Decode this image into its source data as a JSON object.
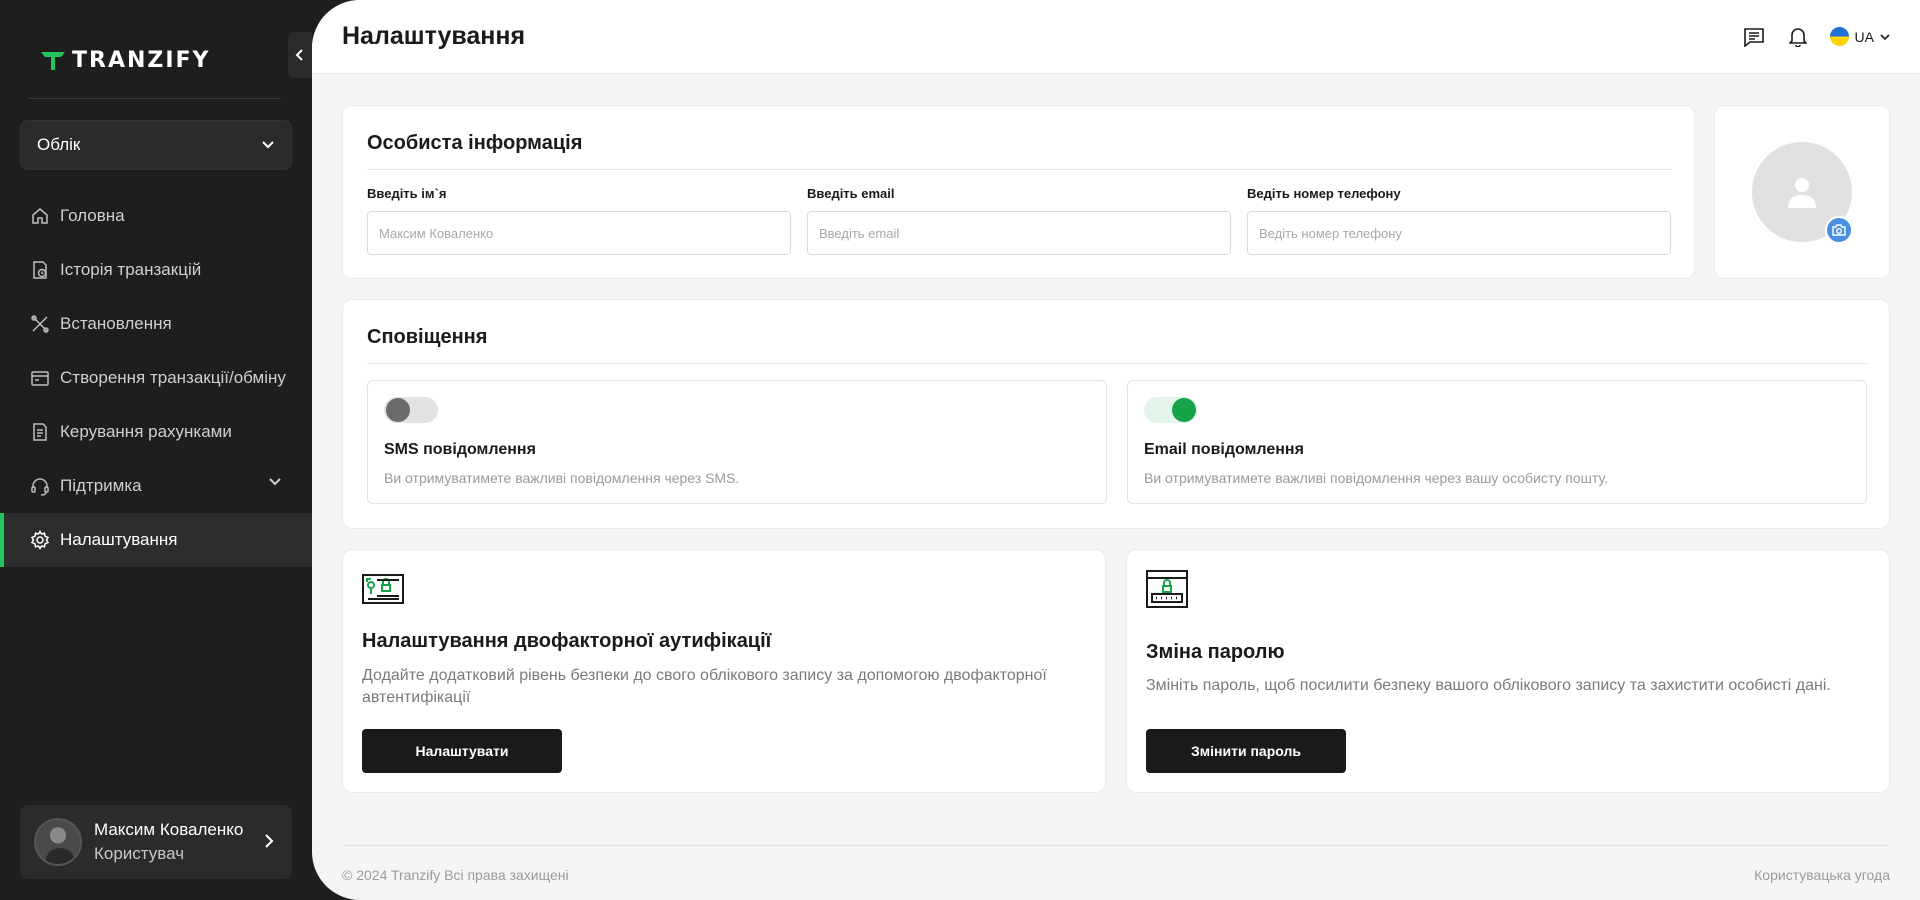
{
  "brand": {
    "name": "TRANZIFY",
    "accent_color": "#22c55e"
  },
  "sidebar": {
    "account_select": "Облік",
    "items": [
      {
        "label": "Головна",
        "icon": "home-icon"
      },
      {
        "label": "Історія транзакцій",
        "icon": "history-icon"
      },
      {
        "label": "Встановлення",
        "icon": "tools-icon"
      },
      {
        "label": "Створення транзакції/обміну",
        "icon": "exchange-icon"
      },
      {
        "label": "Керування рахунками",
        "icon": "accounts-icon"
      },
      {
        "label": "Підтримка",
        "icon": "headset-icon"
      },
      {
        "label": "Налаштування",
        "icon": "gear-icon"
      }
    ],
    "active_item": "Налаштування",
    "user": {
      "name": "Максим Коваленко",
      "role": "Користувач"
    }
  },
  "header": {
    "title": "Налаштування",
    "language": "UA"
  },
  "personal_info": {
    "title": "Особиста інформація",
    "fields": [
      {
        "label": "Введіть ім`я",
        "placeholder": "Максим Коваленко"
      },
      {
        "label": "Введіть email",
        "placeholder": "Введіть email"
      },
      {
        "label": "Ведіть номер телефону",
        "placeholder": "Ведіть номер телефону"
      }
    ]
  },
  "notifications": {
    "title": "Сповіщення",
    "items": [
      {
        "name": "SMS повідомлення",
        "description": "Ви отримуватимете важливі повідомлення через SMS.",
        "enabled": false
      },
      {
        "name": "Email повідомлення",
        "description": "Ви отримуватимете важливі повідомлення через вашу особисту пошту.",
        "enabled": true
      }
    ]
  },
  "security": {
    "two_factor": {
      "title": "Налаштування двофакторної аутифікації",
      "description": "Додайте додатковий рівень безпеки до свого облікового запису за допомогою двофакторної автентифікації",
      "button": "Налаштувати"
    },
    "password": {
      "title": "Зміна паролю",
      "description": "Змініть пароль, щоб посилити безпеку вашого облікового запису та захистити особисті дані.",
      "button": "Змінити пароль"
    }
  },
  "footer": {
    "copyright": "© 2024 Tranzify Всі права захищені",
    "terms_link": "Користувацька угода"
  }
}
